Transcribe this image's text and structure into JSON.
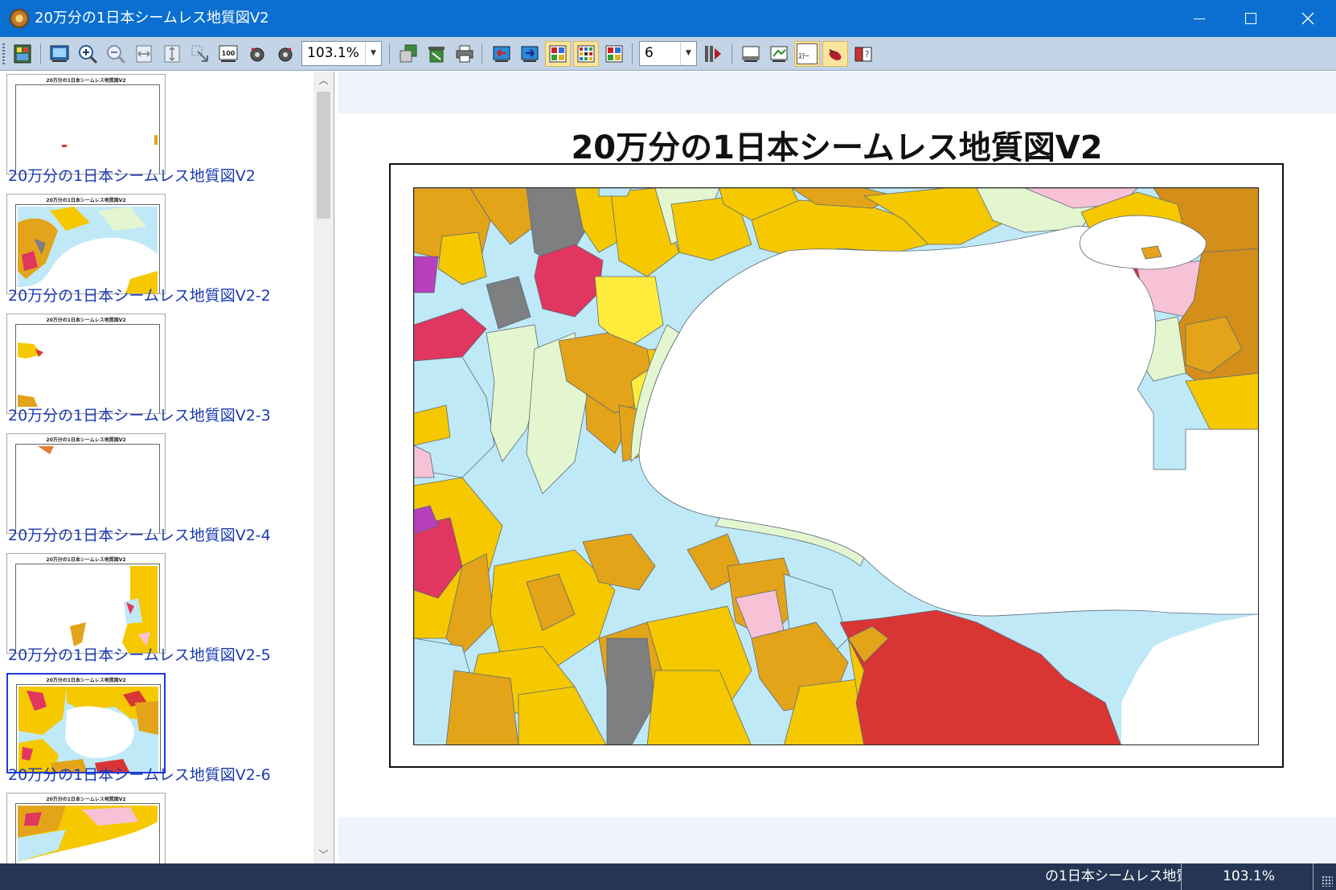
{
  "window": {
    "title": "20万分の1日本シームレス地質図V2",
    "minimize_icon": "minimize-icon",
    "maximize_icon": "maximize-icon",
    "close_icon": "close-icon"
  },
  "toolbar": {
    "zoom_value": "103.1%",
    "page_value": "6",
    "buttons": [
      {
        "name": "export-button",
        "icon": "export-icon"
      },
      {
        "name": "fit-page-button",
        "icon": "fit-page-icon"
      },
      {
        "name": "zoom-in-button",
        "icon": "zoom-in-icon"
      },
      {
        "name": "zoom-out-button",
        "icon": "zoom-out-icon"
      },
      {
        "name": "fit-width-button",
        "icon": "fit-width-icon"
      },
      {
        "name": "fit-height-button",
        "icon": "fit-height-icon"
      },
      {
        "name": "zoom-area-button",
        "icon": "zoom-area-icon"
      },
      {
        "name": "zoom-100-button",
        "icon": "zoom-100-icon"
      },
      {
        "name": "rotate-left-button",
        "icon": "rotate-left-icon"
      },
      {
        "name": "rotate-right-button",
        "icon": "rotate-right-icon"
      },
      {
        "name": "page-setup-button",
        "icon": "page-setup-icon"
      },
      {
        "name": "print-preview-button",
        "icon": "print-preview-icon"
      },
      {
        "name": "print-button",
        "icon": "printer-icon"
      },
      {
        "name": "previous-page-button",
        "icon": "previous-page-icon"
      },
      {
        "name": "next-page-button",
        "icon": "next-page-icon"
      },
      {
        "name": "layout-single-button",
        "icon": "layout-single-icon"
      },
      {
        "name": "layout-multi-button",
        "icon": "layout-multi-icon"
      },
      {
        "name": "layout-grid-button",
        "icon": "layout-grid-icon"
      },
      {
        "name": "go-to-page-button",
        "icon": "go-to-page-icon"
      },
      {
        "name": "view-stage-button",
        "icon": "view-stage-icon"
      },
      {
        "name": "view-edit-button",
        "icon": "view-edit-icon"
      },
      {
        "name": "status-toggle-button",
        "icon": "status-toggle-icon",
        "label": "ｽﾃｰ"
      },
      {
        "name": "pin-button",
        "icon": "pin-icon"
      },
      {
        "name": "help-button",
        "icon": "help-book-icon"
      }
    ]
  },
  "thumbnails": [
    {
      "label": "20万分の1日本シームレス地質図V2",
      "title": "20万分の1日本シームレス地質図V2",
      "selected": false
    },
    {
      "label": "20万分の1日本シームレス地質図V2-2",
      "title": "20万分の1日本シームレス地質図V2",
      "selected": false
    },
    {
      "label": "20万分の1日本シームレス地質図V2-3",
      "title": "20万分の1日本シームレス地質図V2",
      "selected": false
    },
    {
      "label": "20万分の1日本シームレス地質図V2-4",
      "title": "20万分の1日本シームレス地質図V2",
      "selected": false
    },
    {
      "label": "20万分の1日本シームレス地質図V2-5",
      "title": "20万分の1日本シームレス地質図V2",
      "selected": false
    },
    {
      "label": "20万分の1日本シームレス地質図V2-6",
      "title": "20万分の1日本シームレス地質図V2",
      "selected": true
    },
    {
      "label": "",
      "title": "20万分の1日本シームレス地質図V2",
      "selected": false
    }
  ],
  "main": {
    "map_title": "20万分の1日本シームレス地質図V2"
  },
  "status": {
    "document_name": "の1日本シームレス地質",
    "zoom": "103.1%"
  },
  "colors": {
    "titlebar": "#0a6fd0",
    "toolbar": "#c2d4e6",
    "statusbar": "#243653",
    "selected_thumb_border": "#1e3adc",
    "thumb_label": "#1c3ab0",
    "geo_yellow": "#f5c800",
    "geo_orange": "#e3a41a",
    "geo_lightblue": "#bfe9f7",
    "geo_red": "#d93535",
    "geo_crimson": "#e0365f",
    "geo_pink": "#f7c2d5",
    "geo_grey": "#7d7f80",
    "geo_palegreen": "#e4f6cf"
  }
}
